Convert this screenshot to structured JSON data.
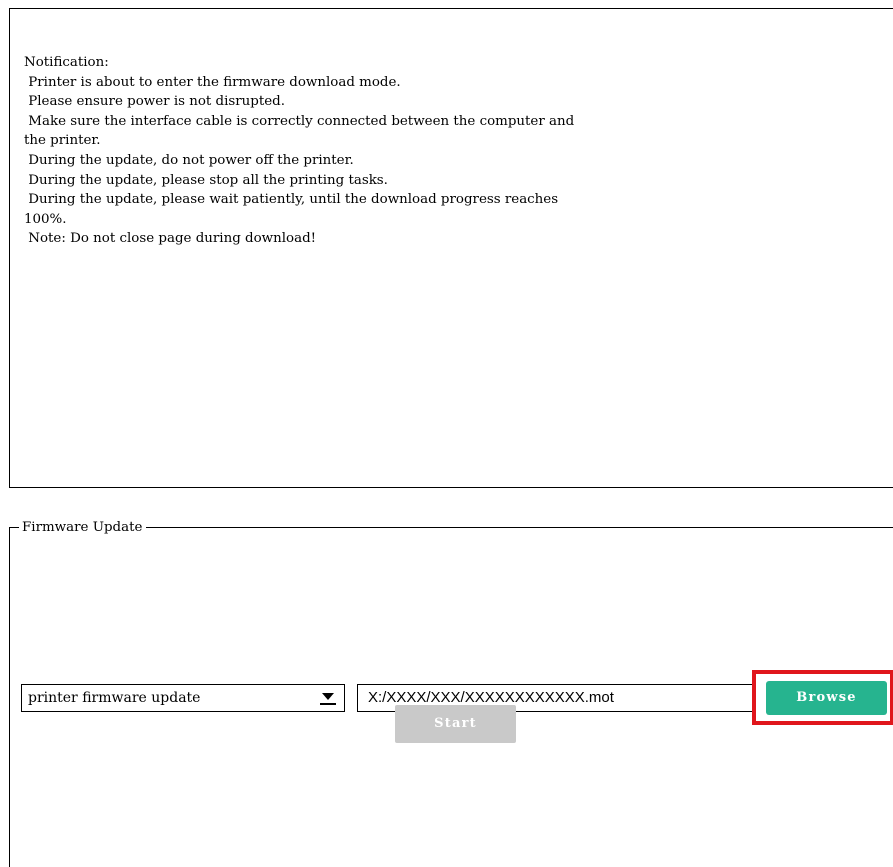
{
  "notification": {
    "lines": [
      "Notification:",
      " Printer is about to enter the firmware download mode.",
      " Please ensure power is not disrupted.",
      " Make sure the interface cable is correctly connected between the computer and",
      "the printer.",
      " During the update, do not power off the printer.",
      " During the update, please stop all the printing tasks.",
      " During the update, please wait patiently, until the download progress reaches",
      "100%.",
      " Note: Do not close page during download!"
    ]
  },
  "firmware_update": {
    "group_label": "Firmware Update",
    "update_type_selected": "printer firmware update",
    "file_path": "X:/XXXX/XXX/XXXXXXXXXXXX.mot",
    "browse_label": "Browse",
    "start_label": "Start"
  },
  "colors": {
    "browse_button": "#26b48f",
    "start_button_disabled": "#c9c9c9",
    "highlight_frame": "#e0161c"
  },
  "icons": {
    "dropdown": "chevron-down-icon"
  }
}
